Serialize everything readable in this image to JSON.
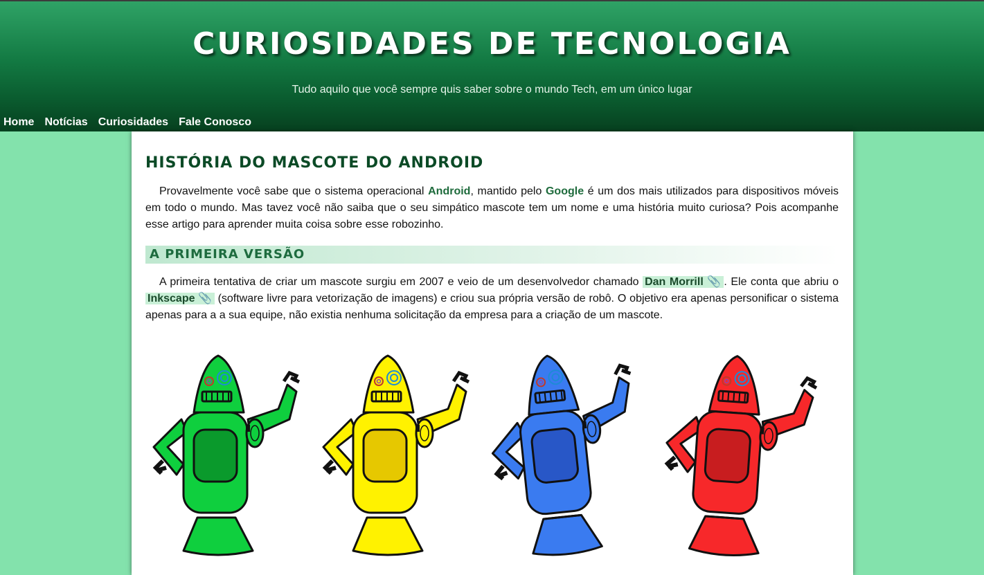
{
  "header": {
    "title": "CURIOSIDADES DE TECNOLOGIA",
    "subtitle": "Tudo aquilo que você sempre quis saber sobre o mundo Tech, em um único lugar"
  },
  "nav": {
    "items": [
      {
        "label": "Home"
      },
      {
        "label": "Notícias"
      },
      {
        "label": "Curiosidades"
      },
      {
        "label": "Fale Conosco"
      }
    ]
  },
  "article": {
    "title": "História do mascote do Android",
    "intro": {
      "t1": "Provavelmente você sabe que o sistema operacional ",
      "android": "Android",
      "t2": ", mantido pelo ",
      "google": "Google",
      "t3": " é um dos mais utilizados para dispositivos móveis em todo o mundo. Mas tavez você não saiba que o seu simpático mascote tem um nome e uma história muito curiosa? Pois acompanhe esse artigo para aprender muita coisa sobre esse robozinho."
    },
    "section1": {
      "title": "A primeira versão",
      "t1": "A primeira tentativa de criar um mascote surgiu em 2007 e veio de um desenvolvedor chamado ",
      "link1": "Dan Morrill",
      "t2": ". Ele conta que abriu o ",
      "link2": "Inkscape",
      "t3": " (software livre para vetorização de imagens) e criou sua própria versão de robô. O objetivo era apenas personificar o sistema apenas para a a sua equipe, não existia nenhuma solicitação da empresa para a criação de um mascote.",
      "link_icon": "paperclip-icon"
    },
    "figure": {
      "robots": [
        {
          "color": "#0fcf3e",
          "dark": "#0a9a2c"
        },
        {
          "color": "#fff200",
          "dark": "#e6c800"
        },
        {
          "color": "#3a7bf0",
          "dark": "#2857c7"
        },
        {
          "color": "#f7282a",
          "dark": "#c81d1f"
        }
      ]
    }
  },
  "colors": {
    "page_bg": "#83e2ac",
    "header_top": "#2fa366",
    "header_bottom": "#07401f",
    "accent_text": "#1e6b3c",
    "link_bg": "#c9f0d7"
  }
}
